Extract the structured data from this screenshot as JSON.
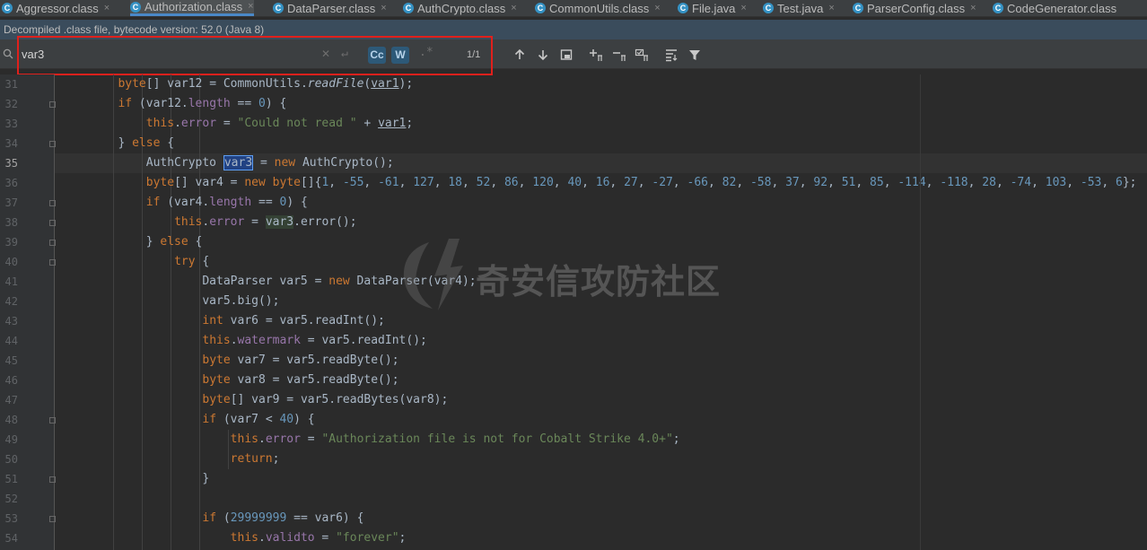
{
  "tabs": [
    {
      "label": "Aggressor.class",
      "active": false
    },
    {
      "label": "Authorization.class",
      "active": true
    },
    {
      "label": "DataParser.class",
      "active": false
    },
    {
      "label": "AuthCrypto.class",
      "active": false
    },
    {
      "label": "CommonUtils.class",
      "active": false
    },
    {
      "label": "File.java",
      "active": false
    },
    {
      "label": "Test.java",
      "active": false
    },
    {
      "label": "ParserConfig.class",
      "active": false
    },
    {
      "label": "CodeGenerator.class",
      "active": false
    }
  ],
  "tab_icon_letter": "C",
  "tab_close_glyph": "×",
  "info_bar": "Decompiled .class file, bytecode version: 52.0 (Java 8)",
  "search": {
    "value": "var3",
    "count": "1/1",
    "clear_glyph": "✕",
    "newline_glyph": "↵",
    "match_case_label": "Cc",
    "words_label": "W",
    "regex_glyph": ".*"
  },
  "line_numbers": [
    "31",
    "32",
    "33",
    "34",
    "35",
    "36",
    "37",
    "38",
    "39",
    "40",
    "41",
    "42",
    "43",
    "44",
    "45",
    "46",
    "47",
    "48",
    "49",
    "50",
    "51",
    "52",
    "53",
    "54"
  ],
  "current_line": "35",
  "watermark": "奇安信攻防社区",
  "colors": {
    "keyword": "#cc7832",
    "string": "#6a8759",
    "number": "#6897bb",
    "field": "#9876aa",
    "text": "#a9b7c6",
    "highlight": "#214283",
    "redbox": "#e0201c"
  }
}
